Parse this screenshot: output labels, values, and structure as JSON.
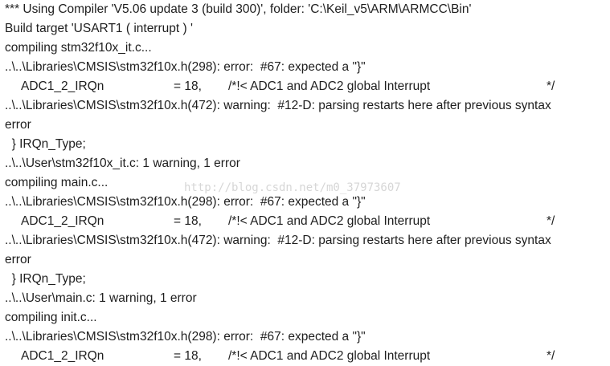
{
  "build_output": {
    "lines": [
      "*** Using Compiler 'V5.06 update 3 (build 300)', folder: 'C:\\Keil_v5\\ARM\\ARMCC\\Bin'",
      "Build target 'USART1 ( interrupt ) '",
      "compiling stm32f10x_it.c...",
      "..\\..\\Libraries\\CMSIS\\stm32f10x.h(298): error:  #67: expected a \"}\"",
      {
        "name": "ADC1_2_IRQn",
        "value": "= 18,",
        "comment": "/*!< ADC1 and ADC2 global Interrupt",
        "end": "*/"
      },
      "..\\..\\Libraries\\CMSIS\\stm32f10x.h(472): warning:  #12-D: parsing restarts here after previous syntax",
      "error",
      "  } IRQn_Type;",
      "..\\..\\User\\stm32f10x_it.c: 1 warning, 1 error",
      "compiling main.c...",
      "..\\..\\Libraries\\CMSIS\\stm32f10x.h(298): error:  #67: expected a \"}\"",
      {
        "name": "ADC1_2_IRQn",
        "value": "= 18,",
        "comment": "/*!< ADC1 and ADC2 global Interrupt",
        "end": "*/"
      },
      "..\\..\\Libraries\\CMSIS\\stm32f10x.h(472): warning:  #12-D: parsing restarts here after previous syntax",
      "error",
      "  } IRQn_Type;",
      "..\\..\\User\\main.c: 1 warning, 1 error",
      "compiling init.c...",
      "..\\..\\Libraries\\CMSIS\\stm32f10x.h(298): error:  #67: expected a \"}\"",
      {
        "name": "ADC1_2_IRQn",
        "value": "= 18,",
        "comment": "/*!< ADC1 and ADC2 global Interrupt",
        "end": "*/"
      }
    ]
  },
  "watermark": "http://blog.csdn.net/m0_37973607"
}
